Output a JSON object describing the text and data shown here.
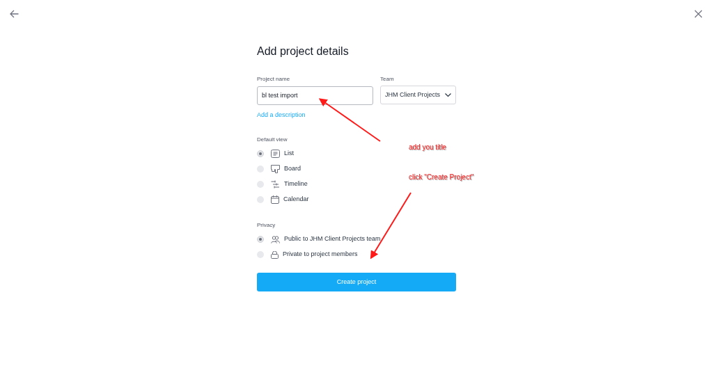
{
  "heading": "Add project details",
  "project_name": {
    "label": "Project name",
    "value": "bl test import"
  },
  "team": {
    "label": "Team",
    "value": "JHM Client Projects"
  },
  "description_link": "Add a description",
  "default_view": {
    "label": "Default view",
    "options": [
      {
        "kind": "list",
        "label": "List",
        "selected": true
      },
      {
        "kind": "board",
        "label": "Board",
        "selected": false
      },
      {
        "kind": "timeline",
        "label": "Timeline",
        "selected": false
      },
      {
        "kind": "calendar",
        "label": "Calendar",
        "selected": false
      }
    ]
  },
  "privacy": {
    "label": "Privacy",
    "options": [
      {
        "kind": "public",
        "label": "Public to JHM Client Projects team",
        "selected": true
      },
      {
        "kind": "private",
        "label": "Private to project members",
        "selected": false
      }
    ]
  },
  "create_button": "Create project",
  "annotations": [
    {
      "text": "add you title"
    },
    {
      "text": "click \"Create Project\""
    }
  ]
}
